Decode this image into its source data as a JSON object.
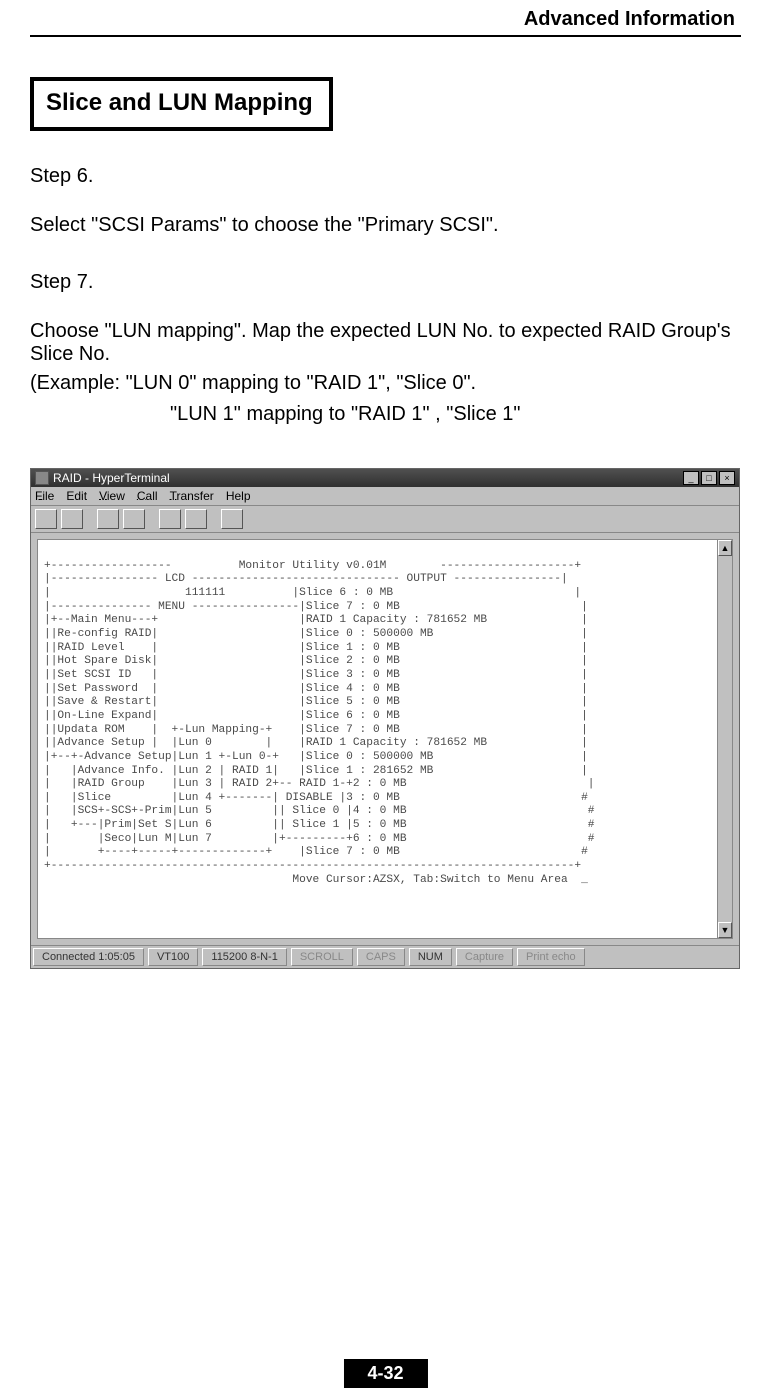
{
  "header": {
    "right_title": "Advanced Information"
  },
  "section": {
    "title": "Slice and LUN Mapping"
  },
  "body": {
    "step6_label": "Step 6.",
    "step6_text": "Select \"SCSI Params\" to choose the \"Primary SCSI\".",
    "step7_label": "Step 7.",
    "step7_text1": "Choose \"LUN mapping\".  Map the expected LUN No. to expected RAID Group's Slice No.",
    "step7_text2": "(Example: \"LUN 0\" mapping to \"RAID 1\", \"Slice 0\".",
    "step7_text3": "\"LUN 1\" mapping to \"RAID 1\"  , \"Slice 1\""
  },
  "screenshot": {
    "window_title": "RAID - HyperTerminal",
    "menus": [
      "File",
      "Edit",
      "View",
      "Call",
      "Transfer",
      "Help"
    ],
    "terminal_text": "\n+------------------          Monitor Utility v0.01M        --------------------+\n|---------------- LCD ------------------------------- OUTPUT ----------------|\n|                    111111          |Slice 6 : 0 MB                           |\n|--------------- MENU ----------------|Slice 7 : 0 MB                           |\n|+--Main Menu---+                     |RAID 1 Capacity : 781652 MB              |\n||Re-config RAID|                     |Slice 0 : 500000 MB                      |\n||RAID Level    |                     |Slice 1 : 0 MB                           |\n||Hot Spare Disk|                     |Slice 2 : 0 MB                           |\n||Set SCSI ID   |                     |Slice 3 : 0 MB                           |\n||Set Password  |                     |Slice 4 : 0 MB                           |\n||Save & Restart|                     |Slice 5 : 0 MB                           |\n||On-Line Expand|                     |Slice 6 : 0 MB                           |\n||Updata ROM    |  +-Lun Mapping-+    |Slice 7 : 0 MB                           |\n||Advance Setup |  |Lun 0        |    |RAID 1 Capacity : 781652 MB              |\n|+--+-Advance Setup|Lun 1 +-Lun 0-+   |Slice 0 : 500000 MB                      |\n|   |Advance Info. |Lun 2 | RAID 1|   |Slice 1 : 281652 MB                      |\n|   |RAID Group    |Lun 3 | RAID 2+-- RAID 1-+2 : 0 MB                           |\n|   |Slice         |Lun 4 +-------| DISABLE |3 : 0 MB                           #\n|   |SCS+-SCS+-Prim|Lun 5         || Slice 0 |4 : 0 MB                           #\n|   +---|Prim|Set S|Lun 6         || Slice 1 |5 : 0 MB                           #\n|       |Seco|Lun M|Lun 7         |+---------+6 : 0 MB                           #\n|       +----+-----+-------------+    |Slice 7 : 0 MB                           #\n+------------------------------------------------------------------------------+\n                                     Move Cursor:AZSX, Tab:Switch to Menu Area  _",
    "status": {
      "connected": "Connected 1:05:05",
      "emulation": "VT100",
      "settings": "115200 8-N-1",
      "scroll": "SCROLL",
      "caps": "CAPS",
      "num": "NUM",
      "capture": "Capture",
      "printecho": "Print echo"
    }
  },
  "footer": {
    "page_number": "4-32"
  }
}
